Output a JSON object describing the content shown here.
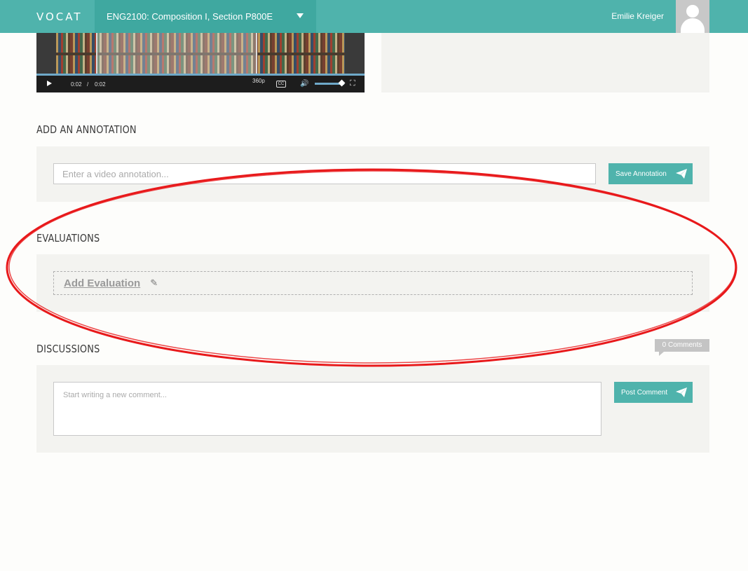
{
  "header": {
    "logo": "VOCAT",
    "course": "ENG2100: Composition I, Section P800E",
    "user_name": "Emilie Kreiger"
  },
  "video": {
    "current_time": "0:02",
    "separator": "/",
    "duration": "0:02",
    "quality": "360p",
    "cc_label": "CC"
  },
  "annotation": {
    "title": "ADD AN ANNOTATION",
    "placeholder": "Enter a video annotation...",
    "save_label": "Save Annotation"
  },
  "evaluations": {
    "title": "EVALUATIONS",
    "add_label": "Add Evaluation"
  },
  "discussions": {
    "title": "DISCUSSIONS",
    "comments_count": "0 Comments",
    "placeholder": "Start writing a new comment...",
    "post_label": "Post Comment"
  },
  "colors": {
    "accent": "#4fb3ac",
    "annotation_ring": "#e8191b"
  }
}
